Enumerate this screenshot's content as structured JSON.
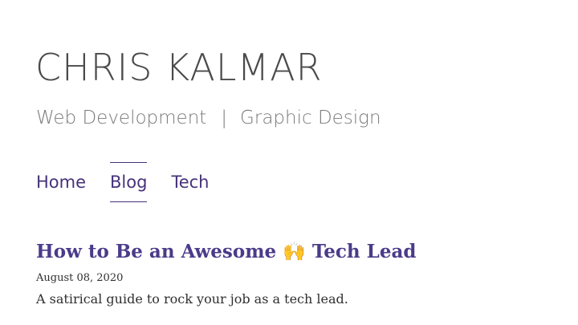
{
  "header": {
    "title": "CHRIS KALMAR",
    "tagline": {
      "left": "Web Development",
      "separator": "|",
      "right": "Graphic Design"
    }
  },
  "nav": {
    "items": [
      {
        "label": "Home",
        "active": false
      },
      {
        "label": "Blog",
        "active": true
      },
      {
        "label": "Tech",
        "active": false
      }
    ]
  },
  "posts": [
    {
      "title": "How to Be an Awesome 🙌 Tech Lead",
      "date": "August 08, 2020",
      "excerpt": "A satirical guide to rock your job as a tech lead."
    }
  ],
  "colors": {
    "accent": "#47327a",
    "title_text": "#4a4a4a",
    "tagline_text": "#7a7a7a"
  }
}
